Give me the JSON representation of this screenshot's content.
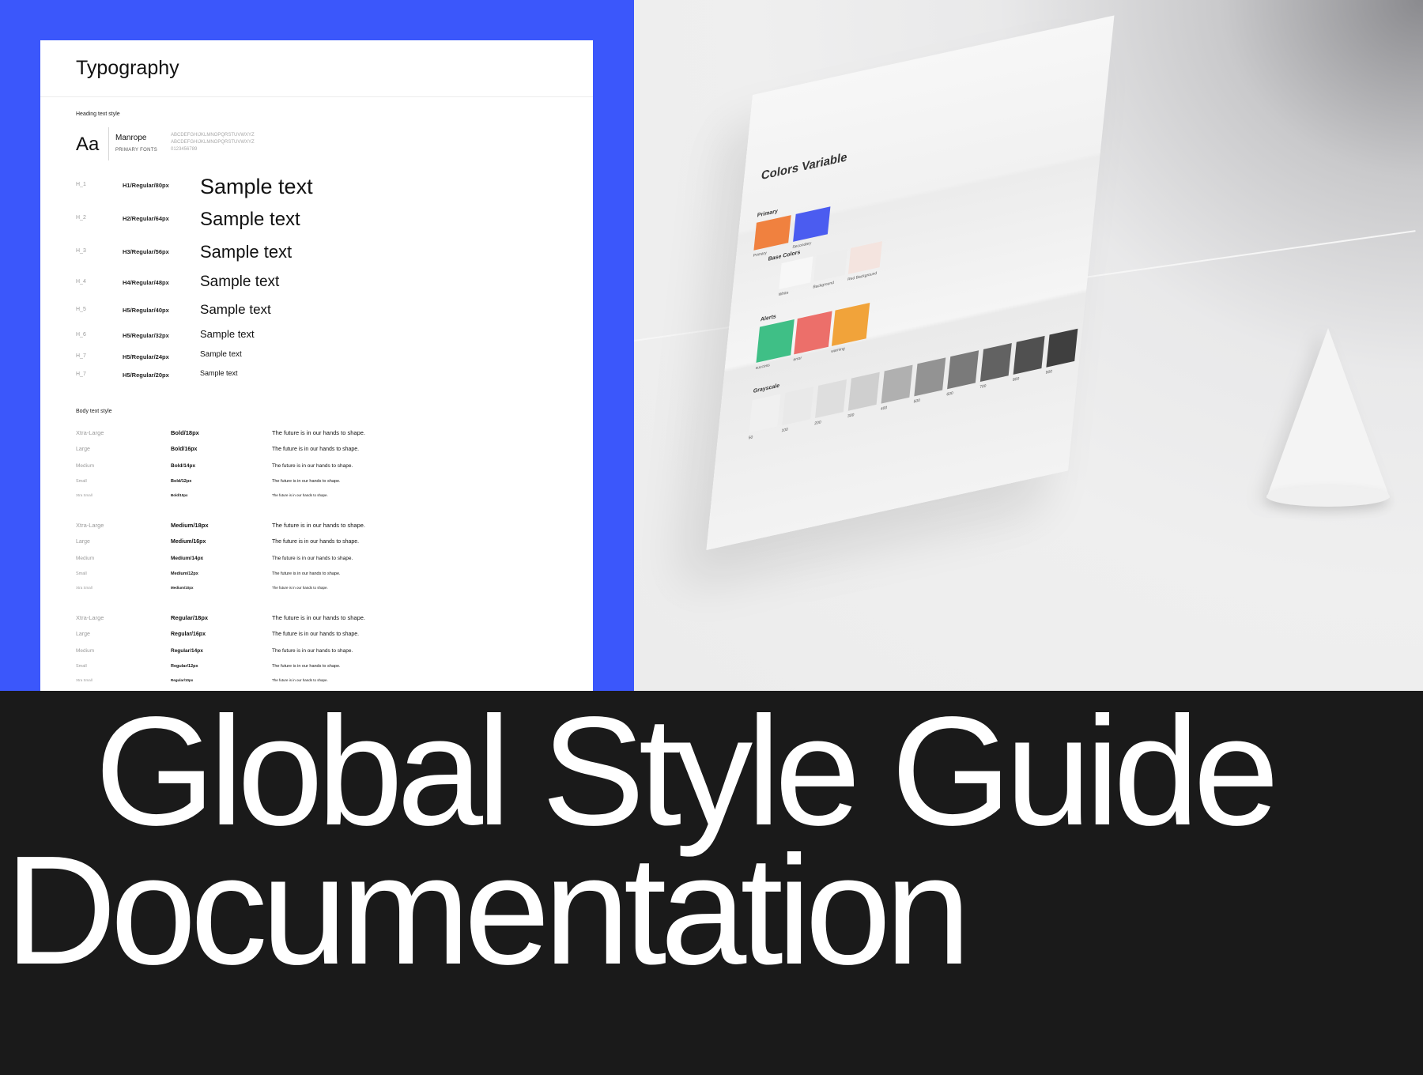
{
  "typography_sheet": {
    "title": "Typography",
    "heading_section_label": "Heading text style",
    "font_sample": "Aa",
    "font_name": "Manrope",
    "font_caption": "PRIMARY FONTS",
    "alphabet_upper": "ABCDEFGHIJKLMNOPQRSTUVWXYZ",
    "alphabet_lower": "ABCDEFGHIJKLMNOPQRSTUVWXYZ",
    "digits": "0123456789",
    "headings": [
      {
        "code": "H_1",
        "spec": "H1/Regular/80px",
        "sample": "Sample text"
      },
      {
        "code": "H_2",
        "spec": "H2/Regular/64px",
        "sample": "Sample text"
      },
      {
        "code": "H_3",
        "spec": "H3/Regular/56px",
        "sample": "Sample text"
      },
      {
        "code": "H_4",
        "spec": "H4/Regular/48px",
        "sample": "Sample text"
      },
      {
        "code": "H_5",
        "spec": "H5/Regular/40px",
        "sample": "Sample text"
      },
      {
        "code": "H_6",
        "spec": "H5/Regular/32px",
        "sample": "Sample text"
      },
      {
        "code": "H_7",
        "spec": "H5/Regular/24px",
        "sample": "Sample text"
      },
      {
        "code": "H_7",
        "spec": "H5/Regular/20px",
        "sample": "Sample text"
      }
    ],
    "body_section_label": "Body text style",
    "body_rows": [
      {
        "size": "Xtra-Large",
        "spec": "Bold/18px",
        "text": "The future is in our hands to shape."
      },
      {
        "size": "Large",
        "spec": "Bold/16px",
        "text": "The future is in our hands to shape."
      },
      {
        "size": "Medium",
        "spec": "Bold/14px",
        "text": "The future is in our hands to shape."
      },
      {
        "size": "Small",
        "spec": "Bold/12px",
        "text": "The future is in our hands to shape."
      },
      {
        "size": "Xtra Small",
        "spec": "Bold/10px",
        "text": "The future is in our hands to shape."
      },
      {
        "size": "Xtra-Large",
        "spec": "Medium/18px",
        "text": "The future is in our hands to shape."
      },
      {
        "size": "Large",
        "spec": "Medium/16px",
        "text": "The future is in our hands to shape."
      },
      {
        "size": "Medium",
        "spec": "Medium/14px",
        "text": "The future is in our hands to shape."
      },
      {
        "size": "Small",
        "spec": "Medium/12px",
        "text": "The future is in our hands to shape."
      },
      {
        "size": "Xtra Small",
        "spec": "Medium/10px",
        "text": "The future is in our hands to shape."
      },
      {
        "size": "Xtra-Large",
        "spec": "Regular/18px",
        "text": "The future is in our hands to shape."
      },
      {
        "size": "Large",
        "spec": "Regular/16px",
        "text": "The future is in our hands to shape."
      },
      {
        "size": "Medium",
        "spec": "Regular/14px",
        "text": "The future is in our hands to shape."
      },
      {
        "size": "Small",
        "spec": "Regular/12px",
        "text": "The future is in our hands to shape."
      },
      {
        "size": "Xtra Small",
        "spec": "Regular/10px",
        "text": "The future is in our hands to shape."
      }
    ]
  },
  "colors_mockup": {
    "title": "Colors Variable",
    "primary_label": "Primary",
    "primary": [
      {
        "name": "Primary",
        "color": "#f0813f"
      },
      {
        "name": "Secondary",
        "color": "#4b5cf0"
      }
    ],
    "base_label": "Base Colors",
    "base": [
      {
        "name": "White",
        "color": "#f7f7f7"
      },
      {
        "name": "Background",
        "color": "#ededed"
      },
      {
        "name": "Red Background",
        "color": "#f4e4df"
      }
    ],
    "alerts_label": "Alerts",
    "alerts": [
      {
        "name": "success",
        "color": "#3fbf86"
      },
      {
        "name": "error",
        "color": "#ec6f6a"
      },
      {
        "name": "warning",
        "color": "#f1a33a"
      }
    ],
    "grayscale_label": "Grayscale",
    "grayscale": [
      {
        "name": "50",
        "color": "#f0f0f0"
      },
      {
        "name": "100",
        "color": "#e9e9e9"
      },
      {
        "name": "200",
        "color": "#dedede"
      },
      {
        "name": "300",
        "color": "#cfcfcf"
      },
      {
        "name": "400",
        "color": "#b0b0b0"
      },
      {
        "name": "500",
        "color": "#939393"
      },
      {
        "name": "600",
        "color": "#7a7a7a"
      },
      {
        "name": "700",
        "color": "#626262"
      },
      {
        "name": "800",
        "color": "#505050"
      },
      {
        "name": "900",
        "color": "#3f3f3f"
      }
    ]
  },
  "headline": {
    "line1": "Global Style Guide",
    "line2": "Documentation"
  },
  "colors": {
    "panel_blue": "#3b57fb",
    "dark_bg": "#1a1a1a",
    "white": "#ffffff"
  }
}
